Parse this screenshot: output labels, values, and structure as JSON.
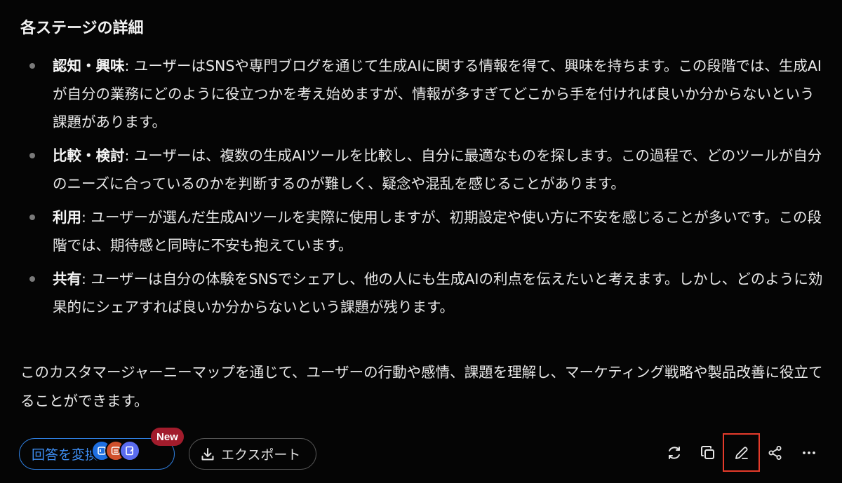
{
  "heading": "各ステージの詳細",
  "stages": [
    {
      "term": "認知・興味",
      "text": ": ユーザーはSNSや専門ブログを通じて生成AIに関する情報を得て、興味を持ちます。この段階では、生成AIが自分の業務にどのように役立つかを考え始めますが、情報が多すぎてどこから手を付ければ良いか分からないという課題があります。"
    },
    {
      "term": "比較・検討",
      "text": ": ユーザーは、複数の生成AIツールを比較し、自分に最適なものを探します。この過程で、どのツールが自分のニーズに合っているのかを判断するのが難しく、疑念や混乱を感じることがあります。"
    },
    {
      "term": "利用",
      "text": ": ユーザーが選んだ生成AIツールを実際に使用しますが、初期設定や使い方に不安を感じることが多いです。この段階では、期待感と同時に不安も抱えています。"
    },
    {
      "term": "共有",
      "text": ": ユーザーは自分の体験をSNSでシェアし、他の人にも生成AIの利点を伝えたいと考えます。しかし、どのように効果的にシェアすれば良いか分からないという課題が残ります。"
    }
  ],
  "summary": "このカスタマージャーニーマップを通じて、ユーザーの行動や感情、課題を理解し、マーケティング戦略や製品改善に役立てることができます。",
  "toolbar": {
    "rephrase_label": "回答を変換",
    "new_badge": "New",
    "export_label": "エクスポート",
    "model_icons": [
      "model-icon-1",
      "model-icon-2",
      "model-icon-3"
    ],
    "actions": [
      "refresh-icon",
      "copy-icon",
      "edit-icon",
      "share-icon",
      "more-icon"
    ]
  },
  "colors": {
    "background": "#050505",
    "accent_blue": "#2f7fe0",
    "badge_red": "#a21c2c",
    "highlight_red": "#e53b2b"
  }
}
